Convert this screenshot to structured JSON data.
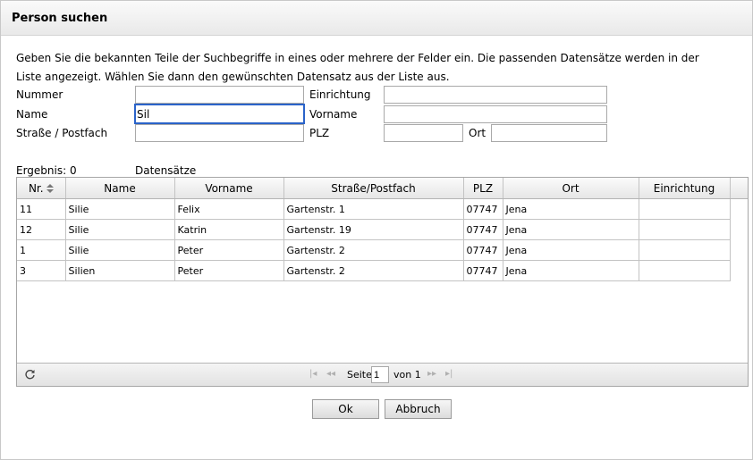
{
  "dialog": {
    "title": "Person suchen"
  },
  "intro": {
    "line1": "Geben Sie die bekannten Teile der Suchbegriffe in eines oder mehrere der Felder ein. Die passenden Datensätze werden in der",
    "line2": "Liste angezeigt. Wählen Sie dann den gewünschten Datensatz aus der Liste aus."
  },
  "form": {
    "nummer_label": "Nummer",
    "nummer_value": "",
    "name_label": "Name",
    "name_value": "Sil",
    "strasse_label": "Straße / Postfach",
    "strasse_value": "",
    "einrichtung_label": "Einrichtung",
    "einrichtung_value": "",
    "vorname_label": "Vorname",
    "vorname_value": "",
    "plz_label": "PLZ",
    "plz_value": "",
    "ort_label": "Ort",
    "ort_value": ""
  },
  "result": {
    "label": "Ergebnis: 0",
    "unit": "Datensätze"
  },
  "table": {
    "headers": [
      "Nr.",
      "Name",
      "Vorname",
      "Straße/Postfach",
      "PLZ",
      "Ort",
      "Einrichtung"
    ],
    "rows": [
      [
        "11",
        "Silie",
        "Felix",
        "Gartenstr.  1",
        "07747",
        "Jena",
        ""
      ],
      [
        "12",
        "Silie",
        "Katrin",
        "Gartenstr.  19",
        "07747",
        "Jena",
        ""
      ],
      [
        "1",
        "Silie",
        "Peter",
        "Gartenstr. 2",
        "07747",
        "Jena",
        ""
      ],
      [
        "3",
        "Silien",
        "Peter",
        "Gartenstr.  2",
        "07747",
        "Jena",
        ""
      ]
    ]
  },
  "pager": {
    "page_label": "Seite",
    "page_value": "1",
    "of_label": "von 1"
  },
  "buttons": {
    "ok": "Ok",
    "cancel": "Abbruch"
  },
  "colors": {
    "focus_border": "#2a63c9"
  }
}
